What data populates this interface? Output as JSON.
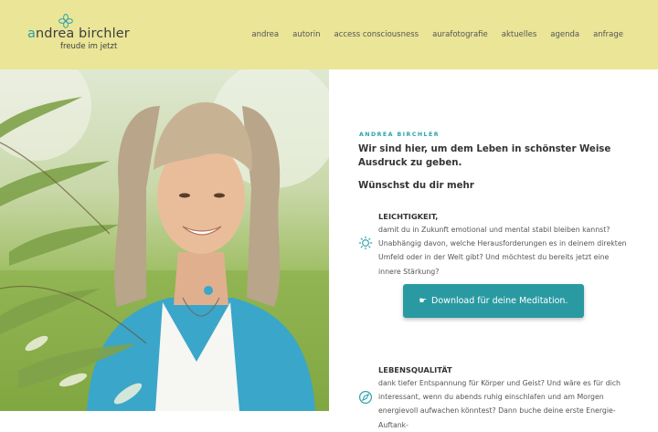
{
  "colors": {
    "header_bg": "#eae597",
    "accent": "#2aa2a8",
    "button_bg": "#2a9aa2"
  },
  "logo": {
    "first_letter": "a",
    "name_rest": "ndrea birchler",
    "tagline": "freude im jetzt",
    "icon": "flower-icon"
  },
  "nav": {
    "items": [
      "andrea",
      "autorin",
      "access consciousness",
      "aurafotografie",
      "aktuelles",
      "agenda",
      "anfrage"
    ]
  },
  "hero_image": {
    "description": "portrait-photo"
  },
  "main": {
    "kicker": "ANDREA BIRCHLER",
    "headline": "Wir sind hier, um dem  Leben in schönster Weise Ausdruck zu geben.",
    "subheadline": "Wünschst du dir mehr",
    "features": [
      {
        "icon": "sun-gear-icon",
        "title": "LEICHTIGKEIT,",
        "text": "damit du in Zukunft emotional und mental stabil bleiben kannst? Unabhängig davon, welche  Herausforderungen es in deinem direkten Umfeld oder in der Welt gibt? Und möchtest du bereits jetzt eine innere Stärkung?"
      },
      {
        "icon": "compass-icon",
        "title": "LEBENSQUALITÄT",
        "text": "dank tiefer  Entspannung für  Körper und Geist? Und wäre es für dich interessant, wenn du abends ruhig einschlafen und am  Morgen energievoll aufwachen könntest? Dann buche deine erste  Energie-Auftank-"
      }
    ],
    "cta": {
      "icon": "pointing-hand-icon",
      "icon_glyph": "☛",
      "label": "Download für deine  Meditation."
    }
  }
}
